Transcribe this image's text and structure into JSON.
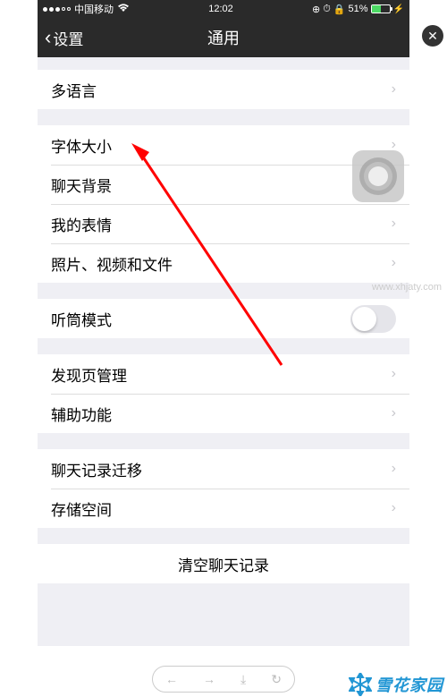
{
  "statusBar": {
    "carrier": "中国移动",
    "time": "12:02",
    "batteryPercent": "51%"
  },
  "navBar": {
    "back": "设置",
    "title": "通用"
  },
  "groups": [
    {
      "rows": [
        {
          "label": "多语言",
          "type": "link"
        }
      ]
    },
    {
      "rows": [
        {
          "label": "字体大小",
          "type": "link"
        },
        {
          "label": "聊天背景",
          "type": "link"
        },
        {
          "label": "我的表情",
          "type": "link"
        },
        {
          "label": "照片、视频和文件",
          "type": "link"
        }
      ]
    },
    {
      "rows": [
        {
          "label": "听筒模式",
          "type": "toggle",
          "on": false
        }
      ]
    },
    {
      "rows": [
        {
          "label": "发现页管理",
          "type": "link"
        },
        {
          "label": "辅助功能",
          "type": "link"
        }
      ]
    },
    {
      "rows": [
        {
          "label": "聊天记录迁移",
          "type": "link"
        },
        {
          "label": "存储空间",
          "type": "link"
        }
      ]
    }
  ],
  "clearButton": "清空聊天记录",
  "watermark": {
    "url": "www.xhjaty.com",
    "brand": "雪花家园"
  }
}
